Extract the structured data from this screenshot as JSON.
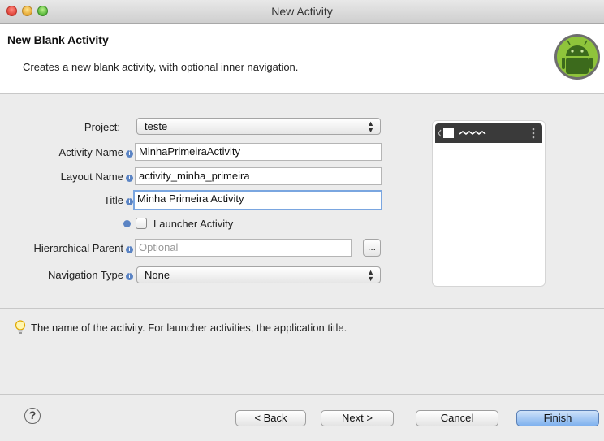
{
  "window": {
    "title": "New Activity"
  },
  "header": {
    "title": "New Blank Activity",
    "description": "Creates a new blank activity, with optional inner navigation."
  },
  "form": {
    "project": {
      "label": "Project:",
      "value": "teste"
    },
    "activity_name": {
      "label": "Activity Name",
      "value": "MinhaPrimeiraActivity"
    },
    "layout_name": {
      "label": "Layout Name",
      "value": "activity_minha_primeira"
    },
    "title": {
      "label": "Title",
      "value": "Minha Primeira Activity"
    },
    "launcher": {
      "label": "Launcher Activity",
      "checked": false
    },
    "hierarchical_parent": {
      "label": "Hierarchical Parent",
      "placeholder": "Optional",
      "browse_label": "..."
    },
    "navigation_type": {
      "label": "Navigation Type",
      "value": "None"
    }
  },
  "hint": {
    "text": "The name of the activity. For launcher activities, the application title."
  },
  "buttons": {
    "help": "?",
    "back": "< Back",
    "next": "Next >",
    "cancel": "Cancel",
    "finish": "Finish"
  },
  "icons": [
    "android-logo-icon",
    "info-icon",
    "lightbulb-icon",
    "help-icon",
    "chevron-updown-icon",
    "overflow-menu-icon"
  ]
}
